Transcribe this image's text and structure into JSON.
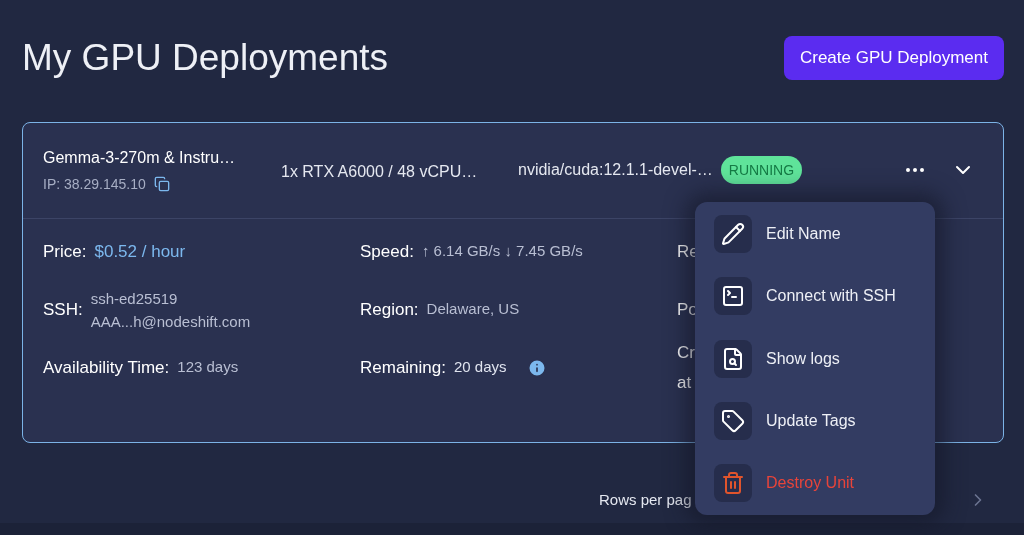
{
  "title": "My GPU Deployments",
  "create_button": "Create GPU Deployment",
  "deployment": {
    "name": "Gemma-3-270m & Instru…",
    "ip": "IP: 38.29.145.10",
    "spec": "1x RTX A6000 / 48 vCPU…",
    "image": "nvidia/cuda:12.1.1-devel-…",
    "status": "RUNNING",
    "expanded": true,
    "details": [
      {
        "label": "Price:",
        "value": "$0.52 / hour",
        "kind": "price"
      },
      {
        "label": "Speed:",
        "value": "↑ 6.14 GB/s ↓ 7.45 GB/s",
        "kind": "plain"
      },
      {
        "label": "Re",
        "kind": "cut"
      },
      {
        "label": "SSH:",
        "lines": [
          "ssh-ed25519",
          "AAA...h@nodeshift.com"
        ],
        "kind": "multiline"
      },
      {
        "label": "Region:",
        "value": "Delaware, US",
        "kind": "plain"
      },
      {
        "label": "Po",
        "kind": "cut"
      },
      {
        "label": "Availability Time:",
        "value": "123 days",
        "kind": "plain"
      },
      {
        "label": "Remaining:",
        "value": "20 days",
        "kind": "info"
      },
      {
        "label": "Cr",
        "label2": "at",
        "kind": "cut"
      }
    ]
  },
  "menu": [
    {
      "label": "Edit Name",
      "kind": "normal"
    },
    {
      "label": "Connect with SSH",
      "kind": "normal"
    },
    {
      "label": "Show logs",
      "kind": "normal"
    },
    {
      "label": "Update Tags",
      "kind": "normal"
    },
    {
      "label": "Destroy Unit",
      "kind": "danger"
    }
  ],
  "pagination": {
    "rows_per_page_label": "Rows per pag"
  }
}
